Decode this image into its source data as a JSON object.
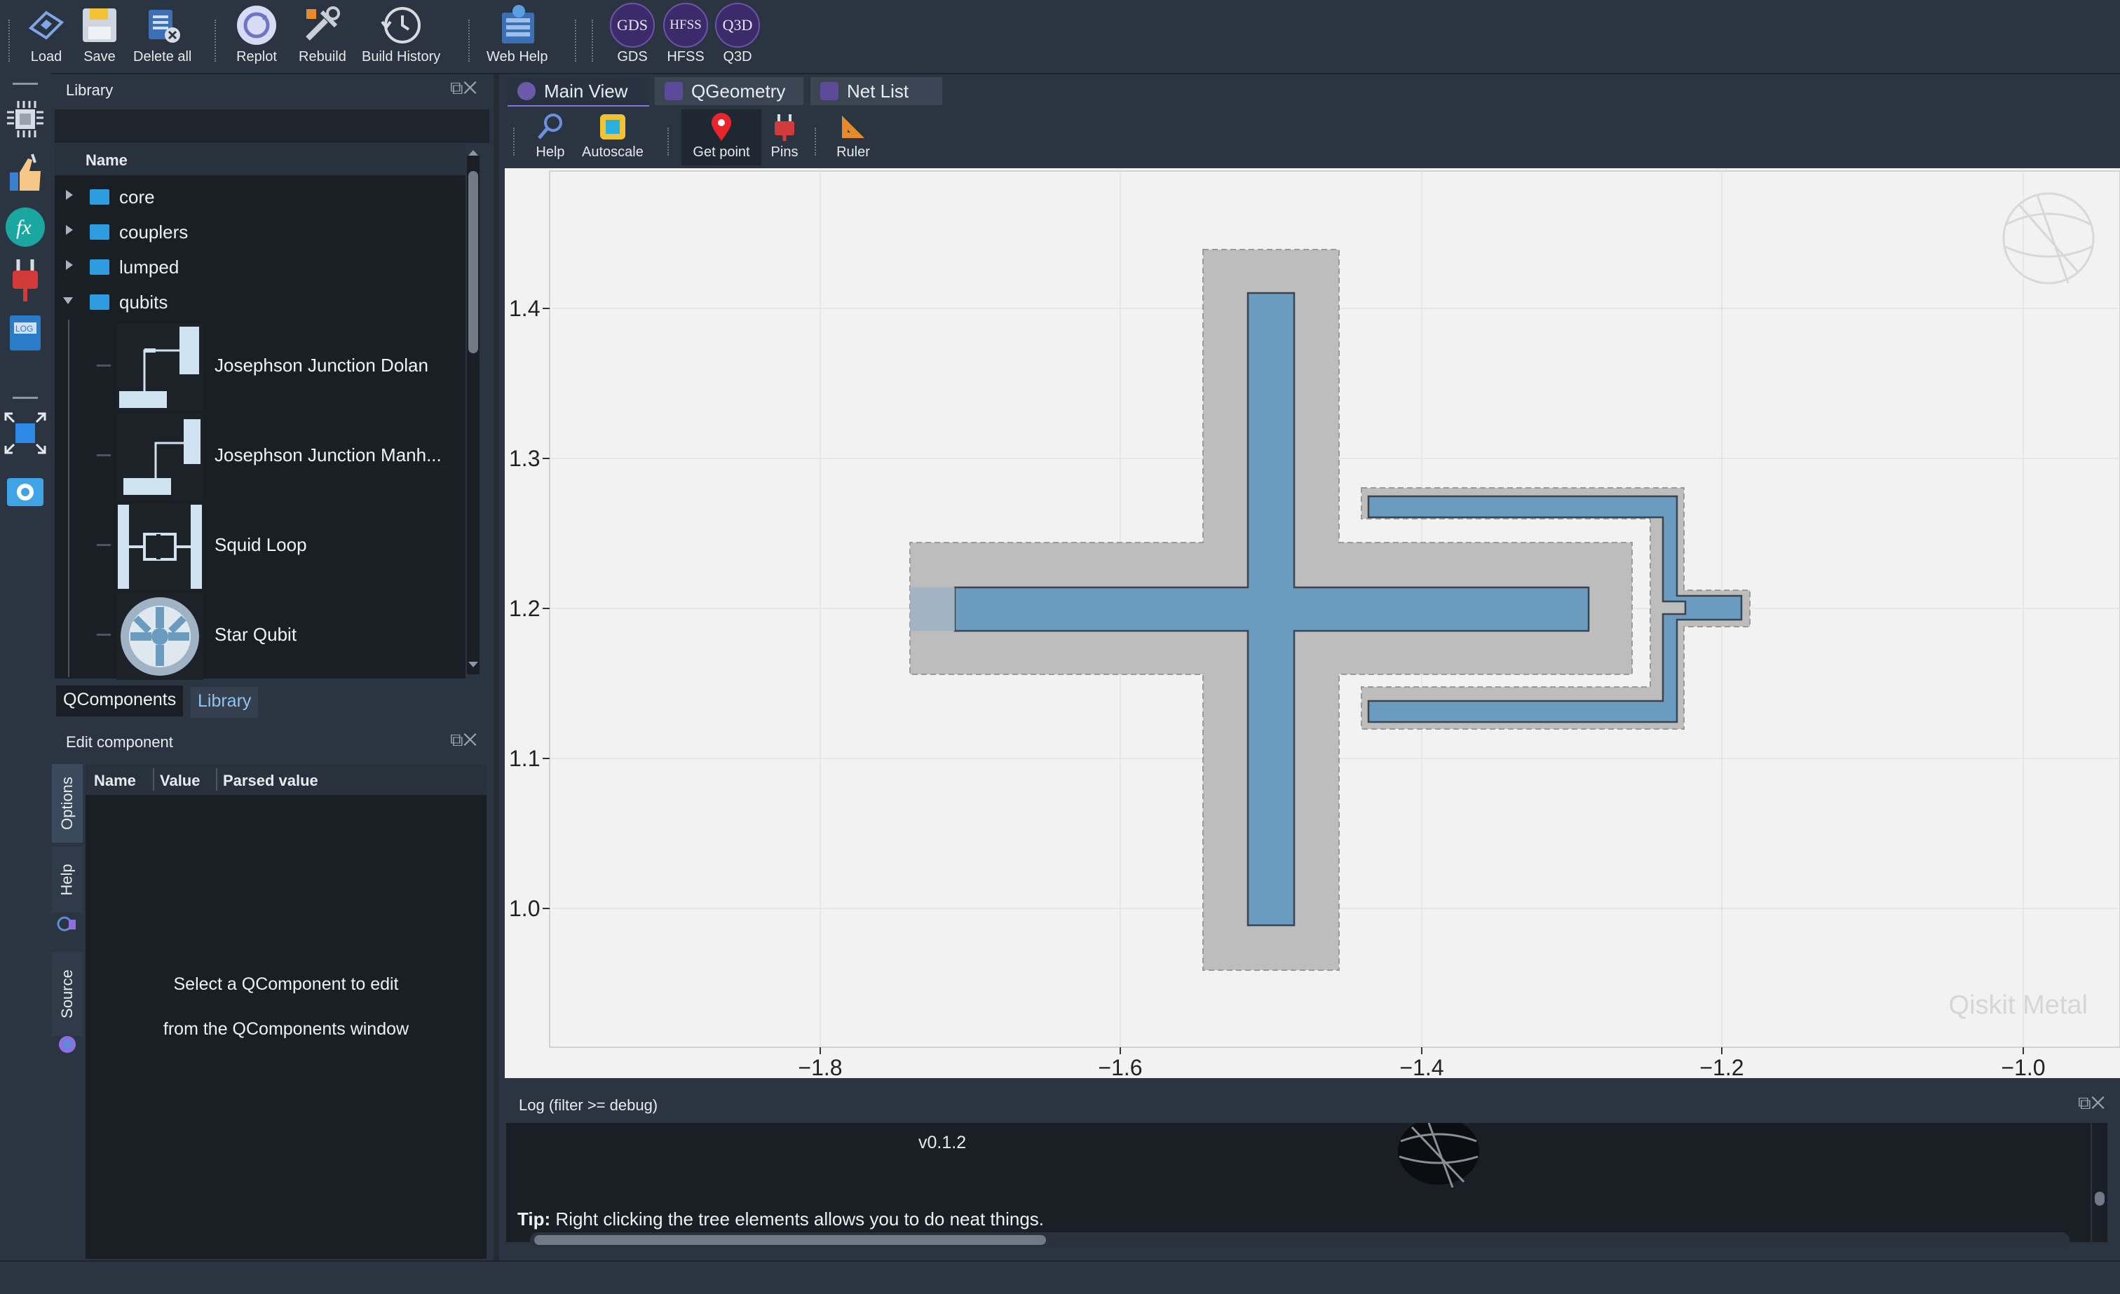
{
  "toolbar": {
    "load": "Load",
    "save": "Save",
    "delete_all": "Delete all",
    "replot": "Replot",
    "rebuild": "Rebuild",
    "build_history": "Build History",
    "web_help": "Web Help",
    "gds_badge": "GDS",
    "gds": "GDS",
    "hfss_badge": "HFSS",
    "hfss": "HFSS",
    "q3d_badge": "Q3D",
    "q3d": "Q3D"
  },
  "leftstrip": {
    "icons": [
      "chip-icon",
      "thumbs-up-icon",
      "function-icon",
      "plug-icon",
      "log-icon",
      "fit-view-icon",
      "camera-icon"
    ]
  },
  "library": {
    "title": "Library",
    "column": "Name",
    "folders": [
      "core",
      "couplers",
      "lumped",
      "qubits"
    ],
    "items": [
      "Josephson Junction Dolan",
      "Josephson Junction Manh...",
      "Squid Loop",
      "Star Qubit"
    ],
    "tabs": {
      "qcomponents": "QComponents",
      "library": "Library"
    }
  },
  "edit": {
    "title": "Edit component",
    "columns": [
      "Name",
      "Value",
      "Parsed value"
    ],
    "vtabs": [
      "Options",
      "Help",
      "Source"
    ],
    "empty_line1": "Select a QComponent to edit",
    "empty_line2": "from the QComponents window"
  },
  "main": {
    "tabs": [
      "Main View",
      "QGeometry",
      "Net List"
    ],
    "tools": {
      "help": "Help",
      "autoscale": "Autoscale",
      "get_point": "Get point",
      "pins": "Pins",
      "ruler": "Ruler"
    },
    "watermark": "Qiskit Metal",
    "x_ticks": [
      "−1.8",
      "−1.6",
      "−1.4",
      "−1.2",
      "−1.0"
    ],
    "y_ticks": [
      "1.4",
      "1.3",
      "1.2",
      "1.1",
      "1.0"
    ]
  },
  "log": {
    "title": "Log  (filter >= debug)",
    "version": "v0.1.2",
    "tip_label": "Tip:",
    "tip_text": " Right clicking the tree elements allows you to do neat things."
  },
  "colors": {
    "accent": "#8e6fe0",
    "metal": "#6b9bbf",
    "ground_cut": "#bdbdbd",
    "folder": "#2d9de0"
  }
}
